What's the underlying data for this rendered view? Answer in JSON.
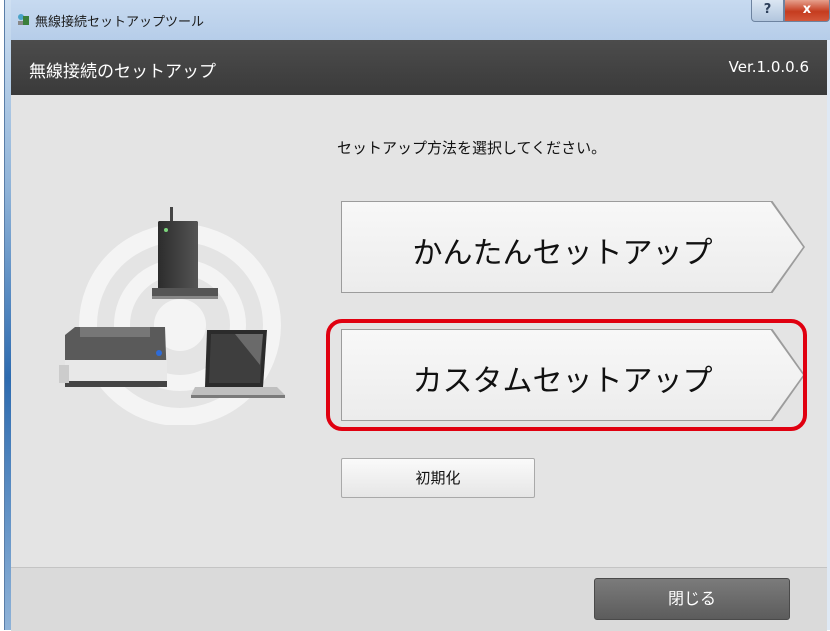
{
  "window": {
    "title": "無線接続セットアップツール",
    "help_label": "?",
    "close_label": "x"
  },
  "header": {
    "title": "無線接続のセットアップ",
    "version": "Ver.1.0.0.6"
  },
  "main": {
    "instruction": "セットアップ方法を選択してください。",
    "easy_setup_label": "かんたんセットアップ",
    "custom_setup_label": "カスタムセットアップ",
    "init_label": "初期化"
  },
  "footer": {
    "close_label": "閉じる"
  },
  "colors": {
    "header_bg": "#3f3f3f",
    "highlight": "#e00010",
    "body_bg": "#e4e4e4"
  }
}
